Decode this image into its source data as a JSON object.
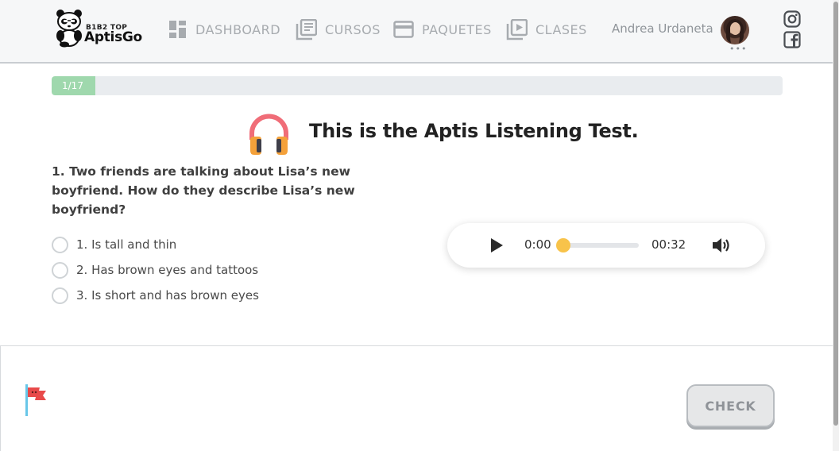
{
  "header": {
    "logo": {
      "top_text": "B1B2 TOP",
      "brand": "AptisGo"
    },
    "nav": [
      {
        "label": "DASHBOARD",
        "icon": "dashboard-icon"
      },
      {
        "label": "CURSOS",
        "icon": "courses-icon"
      },
      {
        "label": "PAQUETES",
        "icon": "card-icon"
      },
      {
        "label": "CLASES",
        "icon": "video-library-icon"
      }
    ],
    "user_name": "Andrea Urdaneta",
    "more": "•••",
    "social": [
      "instagram-icon",
      "facebook-icon"
    ]
  },
  "progress": {
    "label": "1/17",
    "current": 1,
    "total": 17,
    "fill_fraction": 0.06,
    "color": "#9fd8ad"
  },
  "test": {
    "title": "This is the Aptis Listening Test.",
    "question": "1. Two friends are talking about Lisa’s new boyfriend. How do they describe Lisa’s new boyfriend?",
    "options": [
      "1. Is tall and thin",
      "2. Has brown eyes and tattoos",
      "3. Is short and has brown eyes"
    ]
  },
  "audio": {
    "current_time": "0:00",
    "duration": "00:32",
    "progress_fraction": 0.0,
    "accent": "#f8c34a"
  },
  "footer": {
    "check_label": "CHECK"
  },
  "colors": {
    "nav_text": "#a7abaf",
    "header_bg": "#f6f7f8",
    "flag": "#e84a4a"
  }
}
